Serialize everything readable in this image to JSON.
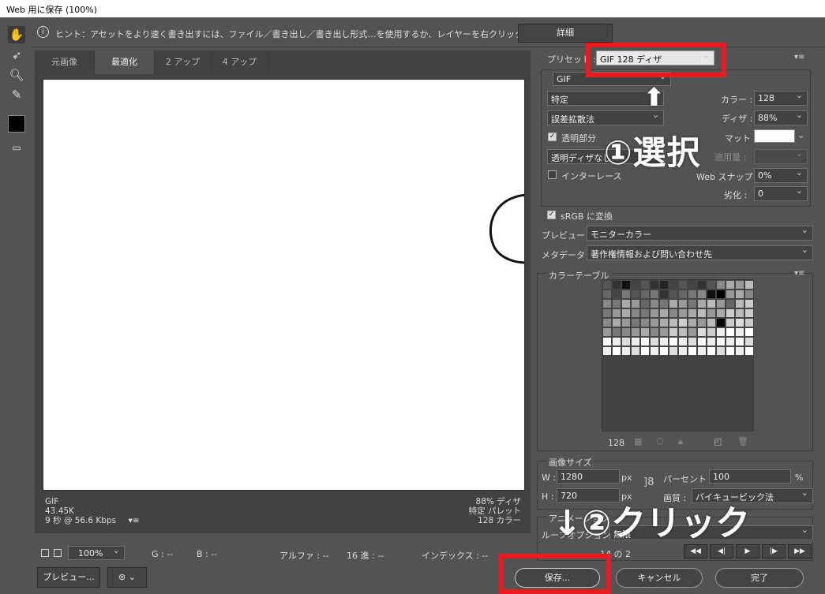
{
  "window": {
    "title": "Web 用に保存 (100%)"
  },
  "hint": {
    "text": "ヒント：アセットをより速く書き出すには、ファイル／書き出し／書き出し形式…を使用するか、レイヤーを右クリックして使用。",
    "detail_button": "詳細"
  },
  "tabs": [
    {
      "label": "元画像",
      "active": false
    },
    {
      "label": "最適化",
      "active": true
    },
    {
      "label": "2 アップ",
      "active": false
    },
    {
      "label": "4 アップ",
      "active": false
    }
  ],
  "canvas_info": {
    "left": [
      "GIF",
      "43.45K",
      "9 秒 @ 56.6 Kbps"
    ],
    "right": [
      "88% ディザ",
      "特定 パレット",
      "128 カラー"
    ]
  },
  "status": {
    "zoom": "100%",
    "g": "G : --",
    "b": "B : --",
    "alpha": "アルファ : --",
    "hex": "16 進 : --",
    "index": "インデックス : --"
  },
  "bottom": {
    "preview_button": "プレビュー...",
    "save_button": "保存...",
    "cancel_button": "キャンセル",
    "done_button": "完了"
  },
  "preset": {
    "label": "プリセット :",
    "value": "GIF 128 ディザ",
    "format": "GIF",
    "palette": "特定",
    "dither_algo": "誤差拡散法",
    "transparency_label": "透明部分",
    "transparency_checked": true,
    "trans_dither": "透明ディザなし",
    "interlace_label": "インターレース",
    "interlace_checked": false,
    "colors_label": "カラー :",
    "colors": "128",
    "dither_label": "ディザ :",
    "dither": "88%",
    "matte_label": "マット :",
    "amount_label": "適用量 :",
    "websnap_label": "Web スナップ :",
    "websnap": "0%",
    "lossy_label": "劣化 :",
    "lossy": "0"
  },
  "srgb": {
    "label": "sRGB に変換",
    "checked": true
  },
  "preview_row": {
    "label": "プレビュー :",
    "value": "モニターカラー"
  },
  "metadata_row": {
    "label": "メタデータ :",
    "value": "著作権情報および問い合わせ先"
  },
  "color_table": {
    "title": "カラーテーブル",
    "count": "128"
  },
  "image_size": {
    "title": "画像サイズ",
    "w_label": "W :",
    "w": "1280",
    "h_label": "H :",
    "h": "720",
    "unit": "px",
    "percent_label": "パーセント :",
    "percent": "100",
    "percent_unit": "%",
    "quality_label": "画質 :",
    "quality": "バイキュービック法"
  },
  "animation": {
    "title": "アニメーション",
    "loop_label": "ループオプション :",
    "loop_value": "無限",
    "frame": "14 の 2"
  },
  "annotations": {
    "step1": "①選択",
    "step2": "↓②クリック",
    "arrow_up": "⬆"
  }
}
